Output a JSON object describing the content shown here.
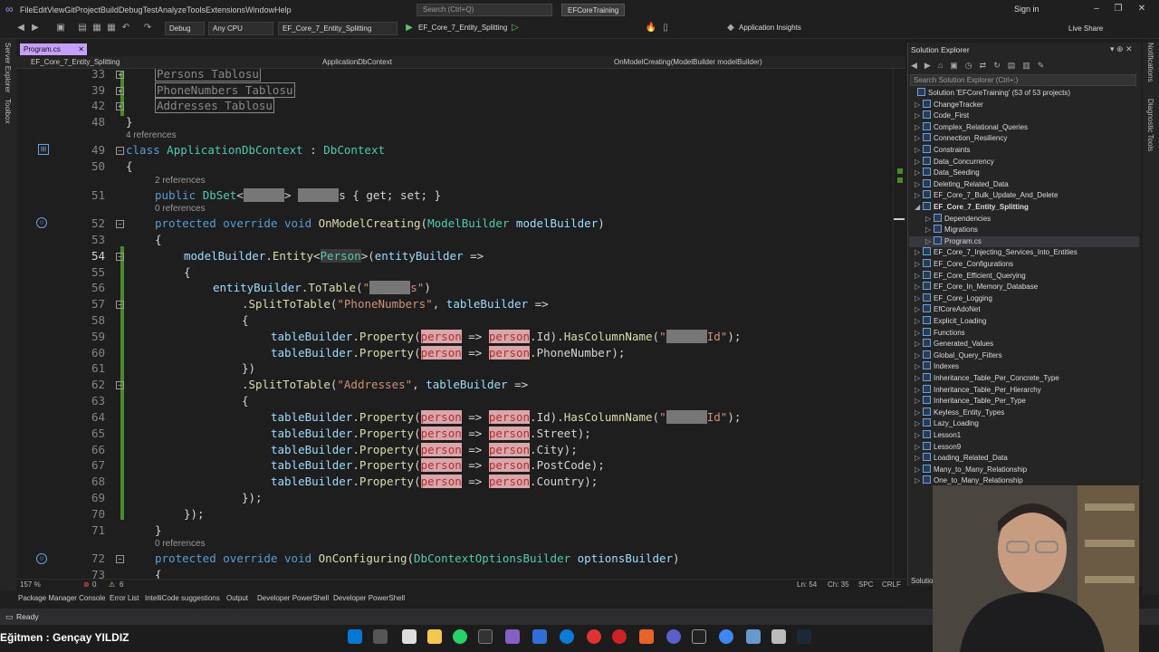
{
  "menubar": {
    "items": [
      "File",
      "Edit",
      "View",
      "Git",
      "Project",
      "Build",
      "Debug",
      "Test",
      "Analyze",
      "Tools",
      "Extensions",
      "Window",
      "Help"
    ],
    "search_placeholder": "Search (Ctrl+Q)",
    "solution_name": "EFCoreTraining",
    "signin": "Sign in"
  },
  "toolbar": {
    "config": "Debug",
    "platform": "Any CPU",
    "startup_project": "EF_Core_7_Entity_Splitting",
    "run_target": "EF_Core_7_Entity_Splitting",
    "insights": "Application Insights",
    "live_share": "Live Share"
  },
  "left_strip": {
    "server_explorer": "Server Explorer",
    "toolbox": "Toolbox"
  },
  "tabs": {
    "active": "Program.cs",
    "close": "✕"
  },
  "navbar": {
    "project": "EF_Core_7_Entity_Splitting",
    "class": "ApplicationDbContext",
    "member": "OnModelCreating(ModelBuilder modelBuilder)"
  },
  "editor": {
    "line_numbers": [
      "33",
      "39",
      "42",
      "48",
      "49",
      "50",
      "51",
      "52",
      "53",
      "54",
      "55",
      "56",
      "57",
      "58",
      "59",
      "60",
      "61",
      "62",
      "63",
      "64",
      "65",
      "66",
      "67",
      "68",
      "69",
      "70",
      "71",
      "72",
      "73"
    ],
    "collapsed": {
      "persons": "Persons Tablosu",
      "phones": "PhoneNumbers Tablosu",
      "addresses": "Addresses Tablosu"
    },
    "refs": {
      "r4": "4 references",
      "r2": "2 references",
      "r0a": "0 references",
      "r0b": "0 references"
    },
    "code": {
      "close_brace": "}",
      "open_brace": "{",
      "class_kw": "class",
      "class_name": "ApplicationDbContext",
      "base": "DbContext",
      "public_kw": "public",
      "dbset": "DbSet",
      "getset": "s { get; set; }",
      "protected_kw": "protected",
      "override_kw": "override",
      "void_kw": "void",
      "on_model_creating": "OnModelCreating",
      "model_builder_type": "ModelBuilder",
      "model_builder_param": "modelBuilder",
      "entity_call": "Entity",
      "person": "Person",
      "entity_builder": "entityBuilder",
      "to_table": "ToTable",
      "split_to_table": "SplitToTable",
      "phone_numbers": "\"PhoneNumbers\"",
      "addresses": "\"Addresses\"",
      "table_builder": "tableBuilder",
      "property": "Property",
      "person_lambda": "person",
      "has_column_name": "HasColumnName",
      "id": "Id",
      "phone_number": "PhoneNumber",
      "street": "Street",
      "city": "City",
      "post_code": "PostCode",
      "country": "Country",
      "on_configuring": "OnConfiguring",
      "options_type": "DbContextOptionsBuilder",
      "options_param": "optionsBuilder",
      "arrow": "=>"
    }
  },
  "editor_status": {
    "zoom": "157 %",
    "errors": "0",
    "warnings": "6",
    "line": "Ln: 54",
    "col": "Ch: 35",
    "spc": "SPC",
    "crlf": "CRLF"
  },
  "tool_tabs": [
    "Package Manager Console",
    "Error List",
    "IntelliCode suggestions",
    "Output",
    "Developer PowerShell",
    "Developer PowerShell"
  ],
  "status": {
    "ready": "Ready"
  },
  "solution_explorer": {
    "title": "Solution Explorer",
    "search_placeholder": "Search Solution Explorer (Ctrl+;)",
    "solution": "Solution 'EFCoreTraining' (53 of 53 projects)",
    "projects_before": [
      "ChangeTracker",
      "Code_First",
      "Complex_Relational_Queries",
      "Connection_Resiliency",
      "Constraints",
      "Data_Concurrency",
      "Data_Seeding",
      "Deleting_Related_Data",
      "EF_Core_7_Bulk_Update_And_Delete"
    ],
    "current_project": "EF_Core_7_Entity_Splitting",
    "children": [
      "Dependencies",
      "Migrations",
      "Program.cs"
    ],
    "projects_after": [
      "EF_Core_7_Injecting_Services_Into_Entities",
      "EF_Core_Configurations",
      "EF_Core_Efficient_Querying",
      "EF_Core_In_Memory_Database",
      "EF_Core_Logging",
      "EfCoreAdoNet",
      "Explicit_Loading",
      "Functions",
      "Generated_Values",
      "Global_Query_Filters",
      "Indexes",
      "Inheritance_Table_Per_Concrete_Type",
      "Inheritance_Table_Per_Hierarchy",
      "Inheritance_Table_Per_Type",
      "Keyless_Entity_Types",
      "Lazy_Loading",
      "Lesson1",
      "Lesson9",
      "Loading_Related_Data",
      "Many_to_Many_Relationship",
      "One_to_Many_Relationship"
    ],
    "bottom_tab": "Solution"
  },
  "right_strip": {
    "notifications": "Notifications",
    "diagnostic": "Diagnostic Tools"
  },
  "watermark": "Eğitmen : Gençay YILDIZ",
  "colors": {
    "accent": "#c5a0ff",
    "keyword": "#569cd6",
    "type": "#4ec9b0",
    "method": "#dcdcaa",
    "string": "#ce9178"
  }
}
